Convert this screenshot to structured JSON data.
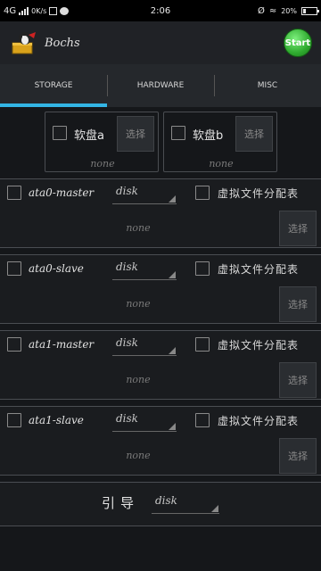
{
  "status_bar": {
    "network": "4G",
    "speed": "0K/s",
    "time": "2:06",
    "battery": "20%"
  },
  "app": {
    "title": "Bochs",
    "start_label": "Start"
  },
  "tabs": [
    {
      "label": "STORAGE"
    },
    {
      "label": "HARDWARE"
    },
    {
      "label": "MISC"
    }
  ],
  "floppies": [
    {
      "label": "软盘a",
      "pick": "选择",
      "value": "none"
    },
    {
      "label": "软盘b",
      "pick": "选择",
      "value": "none"
    }
  ],
  "disks": [
    {
      "name": "ata0-master",
      "type": "disk",
      "vfat_label": "虚拟文件分配表",
      "value": "none",
      "pick": "选择"
    },
    {
      "name": "ata0-slave",
      "type": "disk",
      "vfat_label": "虚拟文件分配表",
      "value": "none",
      "pick": "选择"
    },
    {
      "name": "ata1-master",
      "type": "disk",
      "vfat_label": "虚拟文件分配表",
      "value": "none",
      "pick": "选择"
    },
    {
      "name": "ata1-slave",
      "type": "disk",
      "vfat_label": "虚拟文件分配表",
      "value": "none",
      "pick": "选择"
    }
  ],
  "boot": {
    "label": "引导",
    "value": "disk"
  },
  "colors": {
    "accent": "#33b5e5",
    "start": "#3cb93c"
  }
}
